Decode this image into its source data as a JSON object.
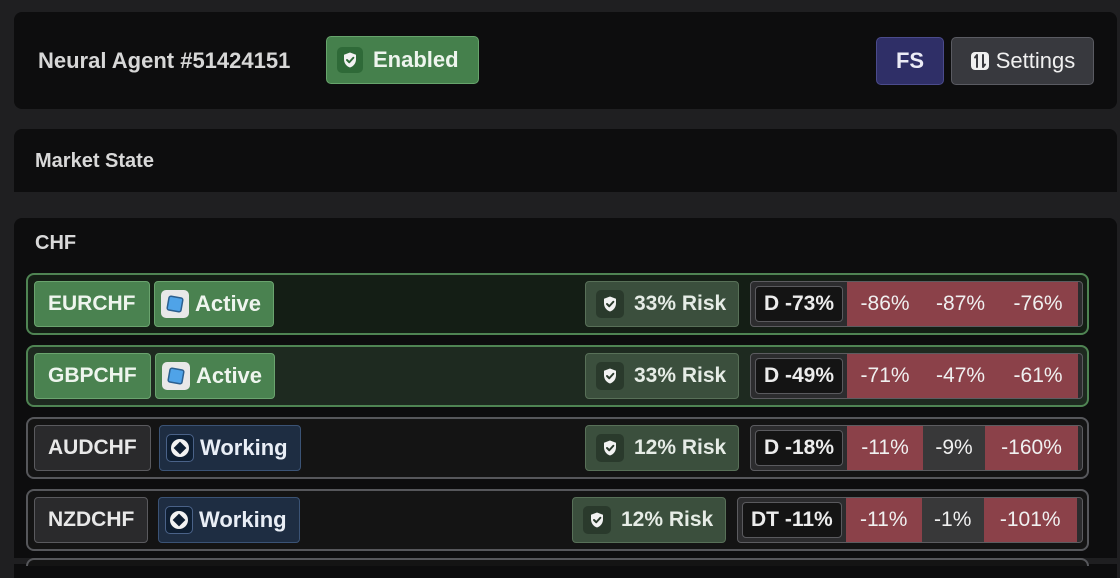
{
  "header": {
    "agent_title": "Neural Agent #51424151",
    "enabled_label": "Enabled",
    "fs_label": "FS",
    "settings_label": "Settings"
  },
  "sections": {
    "market_state_title": "Market State",
    "chf_title": "CHF"
  },
  "rows": [
    {
      "symbol": "EURCHF",
      "status": "Active",
      "risk": "33% Risk",
      "d_label": "D -73%",
      "cells": [
        "-86%",
        "-87%",
        "-76%"
      ]
    },
    {
      "symbol": "GBPCHF",
      "status": "Active",
      "risk": "33% Risk",
      "d_label": "D -49%",
      "cells": [
        "-71%",
        "-47%",
        "-61%"
      ]
    },
    {
      "symbol": "AUDCHF",
      "status": "Working",
      "risk": "12% Risk",
      "d_label": "D -18%",
      "cells": [
        "-11%",
        "-9%",
        "-160%"
      ]
    },
    {
      "symbol": "NZDCHF",
      "status": "Working",
      "risk": "12% Risk",
      "d_label": "DT -11%",
      "cells": [
        "-11%",
        "-1%",
        "-101%"
      ]
    }
  ],
  "colors": {
    "active_green": "#4a8250",
    "working_blue": "#1e2d42",
    "negative_red": "#8b4149",
    "fs_purple": "#2f2f67"
  },
  "icons": {
    "enabled": "shield-check-icon",
    "settings": "sliders-icon",
    "active_status": "cube-icon",
    "working_status": "diamond-icon",
    "risk": "shield-check-icon"
  }
}
